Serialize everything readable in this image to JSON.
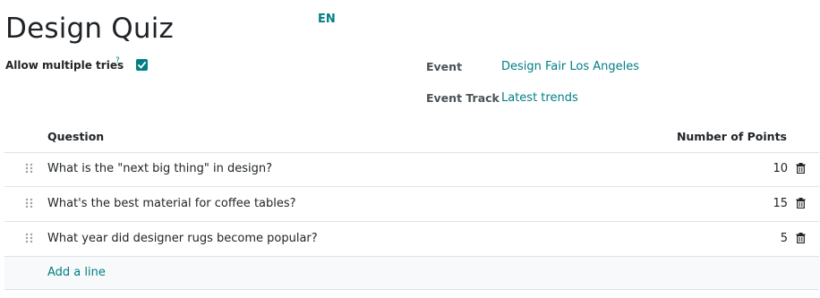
{
  "header": {
    "title": "Design Quiz",
    "language_badge": "EN"
  },
  "form": {
    "allow_multiple_tries_label": "Allow multiple tries",
    "help_mark": "?",
    "allow_multiple_tries_checked": true,
    "event_label": "Event",
    "event_value": "Design Fair Los Angeles",
    "event_track_label": "Event Track",
    "event_track_value": "Latest trends"
  },
  "table": {
    "columns": {
      "question": "Question",
      "points": "Number of Points"
    },
    "rows": [
      {
        "question": "What is the \"next big thing\" in design?",
        "points": "10"
      },
      {
        "question": "What's the best material for coffee tables?",
        "points": "15"
      },
      {
        "question": "What year did designer rugs become popular?",
        "points": "5"
      }
    ],
    "add_line_label": "Add a line"
  },
  "icons": {
    "checkbox": "check-icon",
    "drag_handle": "drag-handle-icon",
    "delete": "trash-icon"
  },
  "colors": {
    "accent": "#017e84",
    "text": "#212529",
    "border": "#dee2e6",
    "add_row_background": "#f8f9fa"
  }
}
